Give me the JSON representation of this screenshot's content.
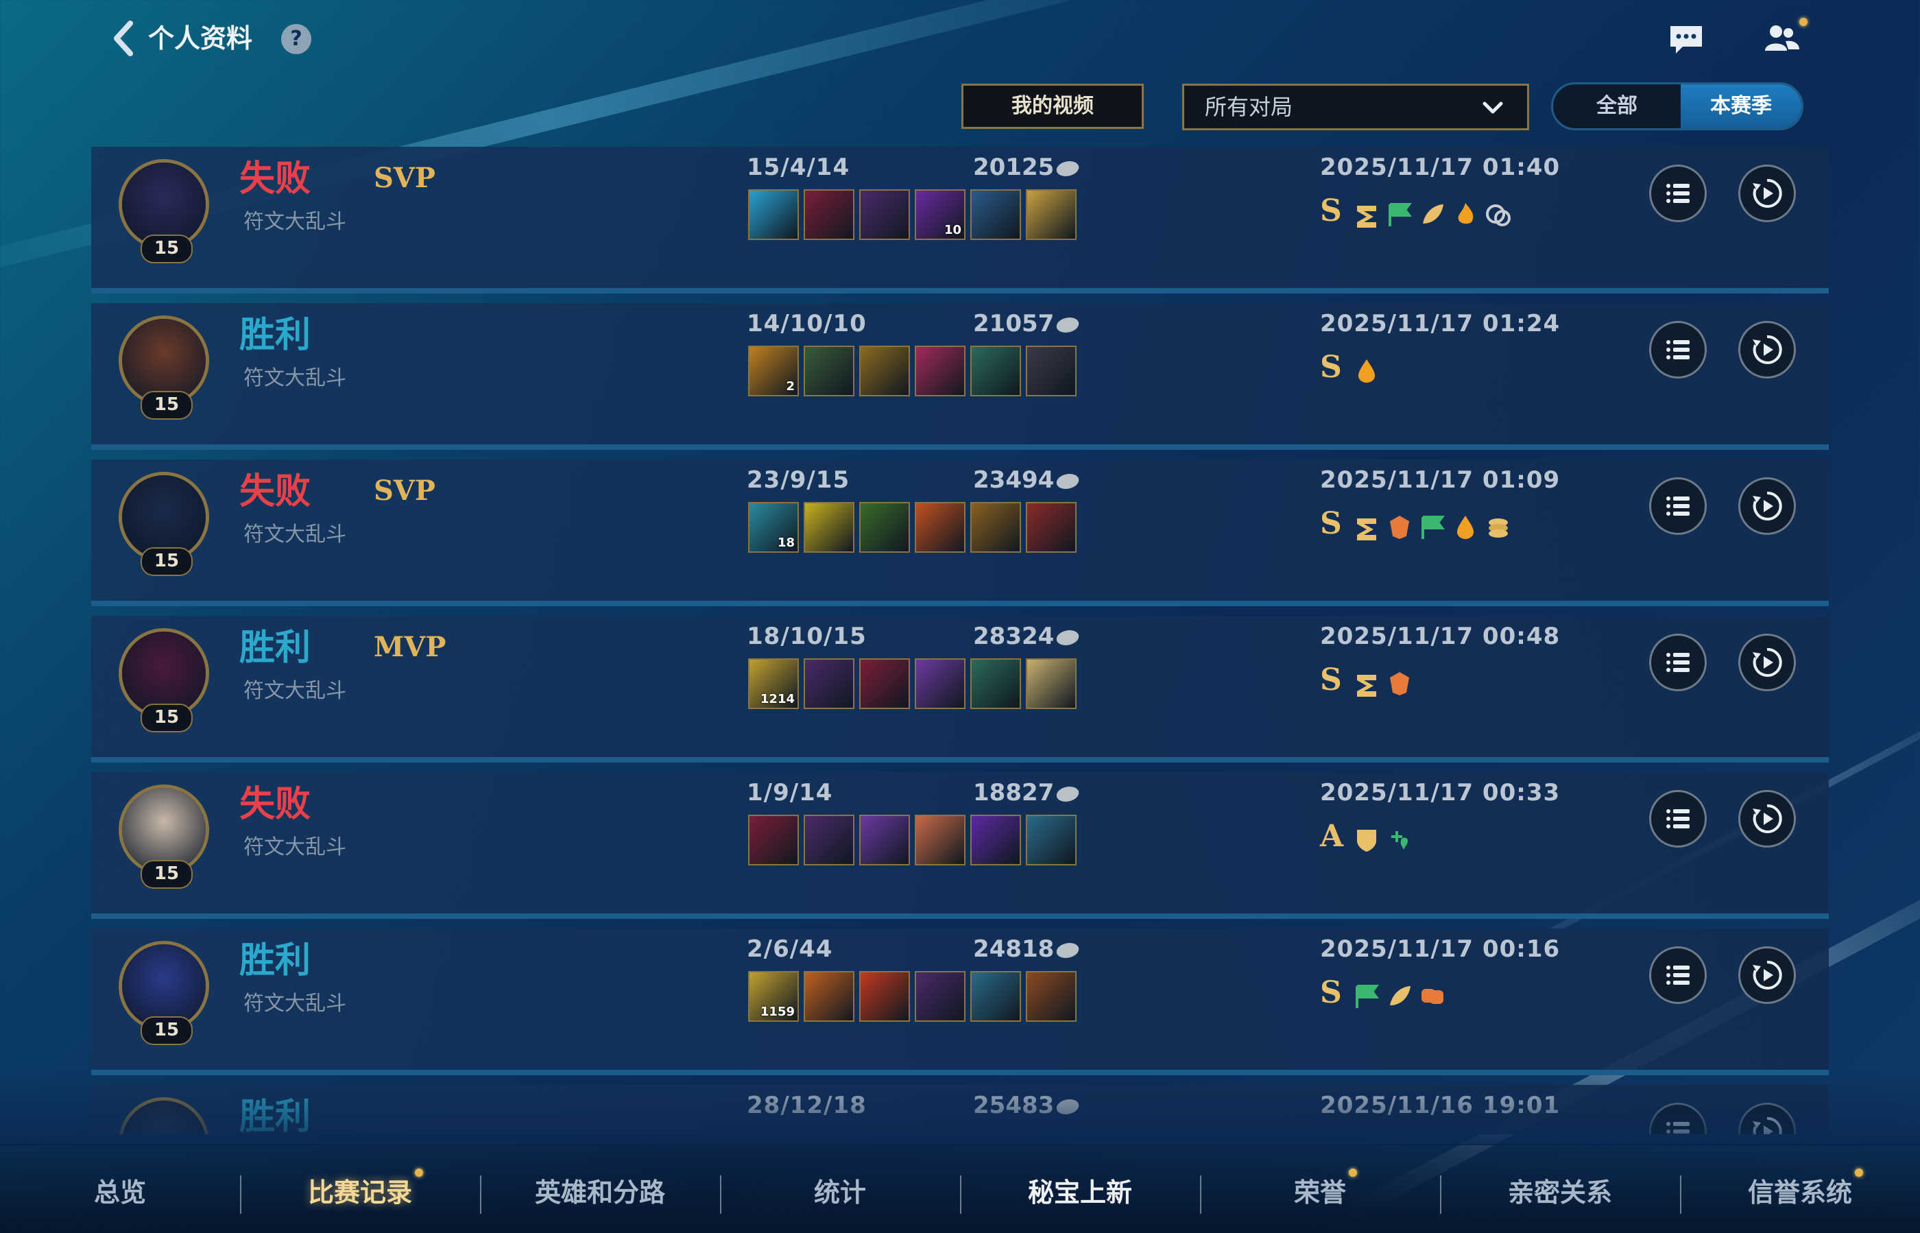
{
  "header": {
    "title": "个人资料",
    "help": "?",
    "video_button": "我的视频",
    "filter_value": "所有对局",
    "toggle": {
      "all": "全部",
      "season": "本赛季"
    }
  },
  "matches": [
    {
      "result": "失败",
      "result_type": "lose",
      "award": "SVP",
      "mode": "符文大乱斗",
      "level": "15",
      "kda": "15/4/14",
      "gold": "20125",
      "date": "2025/11/17 01:40",
      "grade": "S",
      "items": [
        {
          "c": "#2aa0d0",
          "n": ""
        },
        {
          "c": "#7a1e3a",
          "n": ""
        },
        {
          "c": "#4a2a6a",
          "n": ""
        },
        {
          "c": "#6a2aa0",
          "n": "10"
        },
        {
          "c": "#2a5a8a",
          "n": ""
        },
        {
          "c": "#c8a040",
          "n": ""
        }
      ],
      "tags": [
        "three",
        "flag",
        "leaf",
        "flame",
        "coin-link"
      ]
    },
    {
      "result": "胜利",
      "result_type": "win",
      "award": "",
      "mode": "符文大乱斗",
      "level": "15",
      "kda": "14/10/10",
      "gold": "21057",
      "date": "2025/11/17 01:24",
      "grade": "S",
      "items": [
        {
          "c": "#c08020",
          "n": "2"
        },
        {
          "c": "#3a5a3a",
          "n": ""
        },
        {
          "c": "#8a6a20",
          "n": ""
        },
        {
          "c": "#a02a5a",
          "n": ""
        },
        {
          "c": "#2a6a5a",
          "n": ""
        },
        {
          "c": "#3a3a4a",
          "n": ""
        }
      ],
      "tags": [
        "drop"
      ]
    },
    {
      "result": "失败",
      "result_type": "lose",
      "award": "SVP",
      "mode": "符文大乱斗",
      "level": "15",
      "kda": "23/9/15",
      "gold": "23494",
      "date": "2025/11/17 01:09",
      "grade": "S",
      "items": [
        {
          "c": "#2a8aa0",
          "n": "18"
        },
        {
          "c": "#c8b020",
          "n": ""
        },
        {
          "c": "#3a6a2a",
          "n": ""
        },
        {
          "c": "#c05020",
          "n": ""
        },
        {
          "c": "#8a6020",
          "n": ""
        },
        {
          "c": "#8a2a2a",
          "n": ""
        }
      ],
      "tags": [
        "three",
        "crest",
        "flag",
        "drop",
        "coins"
      ]
    },
    {
      "result": "胜利",
      "result_type": "win",
      "award": "MVP",
      "mode": "符文大乱斗",
      "level": "15",
      "kda": "18/10/15",
      "gold": "28324",
      "date": "2025/11/17 00:48",
      "grade": "S",
      "items": [
        {
          "c": "#c0a030",
          "n": "1214"
        },
        {
          "c": "#4a2a6a",
          "n": ""
        },
        {
          "c": "#7a1e3a",
          "n": ""
        },
        {
          "c": "#6a3aa0",
          "n": ""
        },
        {
          "c": "#2a6a5a",
          "n": ""
        },
        {
          "c": "#c8b070",
          "n": ""
        }
      ],
      "tags": [
        "three",
        "crest"
      ]
    },
    {
      "result": "失败",
      "result_type": "lose",
      "award": "",
      "mode": "符文大乱斗",
      "level": "15",
      "kda": "1/9/14",
      "gold": "18827",
      "date": "2025/11/17 00:33",
      "grade": "A",
      "items": [
        {
          "c": "#7a1e3a",
          "n": ""
        },
        {
          "c": "#4a2a6a",
          "n": ""
        },
        {
          "c": "#6a3aa0",
          "n": ""
        },
        {
          "c": "#c86a4a",
          "n": ""
        },
        {
          "c": "#5a2aa0",
          "n": ""
        },
        {
          "c": "#2a6a8a",
          "n": ""
        }
      ],
      "tags": [
        "shield-leaf",
        "heart-plus"
      ]
    },
    {
      "result": "胜利",
      "result_type": "win",
      "award": "",
      "mode": "符文大乱斗",
      "level": "15",
      "kda": "2/6/44",
      "gold": "24818",
      "date": "2025/11/17 00:16",
      "grade": "S",
      "items": [
        {
          "c": "#c0a030",
          "n": "1159"
        },
        {
          "c": "#c06020",
          "n": ""
        },
        {
          "c": "#c03a20",
          "n": ""
        },
        {
          "c": "#4a2a6a",
          "n": ""
        },
        {
          "c": "#2a6a8a",
          "n": ""
        },
        {
          "c": "#8a4a20",
          "n": ""
        }
      ],
      "tags": [
        "flag",
        "leaf",
        "link"
      ]
    },
    {
      "result": "胜利",
      "result_type": "win",
      "award": "",
      "mode": "",
      "level": "",
      "kda": "28/12/18",
      "gold": "25483",
      "date": "2025/11/16 19:01",
      "grade": "",
      "items": [],
      "tags": []
    }
  ],
  "nav": {
    "tabs": [
      {
        "label": "总览",
        "dot": false
      },
      {
        "label": "比赛记录",
        "dot": true
      },
      {
        "label": "英雄和分路",
        "dot": false
      },
      {
        "label": "统计",
        "dot": false
      },
      {
        "label": "秘宝上新",
        "dot": false
      },
      {
        "label": "荣誉",
        "dot": true
      },
      {
        "label": "亲密关系",
        "dot": false
      },
      {
        "label": "信誉系统",
        "dot": true
      }
    ],
    "active_index": 1
  },
  "colors": {
    "lose": "#e8414a",
    "win": "#2aa9cc",
    "gold_accent": "#8a7442",
    "award": "#e2b45a"
  },
  "icons": {
    "back": "chevron-left-icon",
    "help": "question-icon",
    "chat": "chat-bubble-icon",
    "friends": "friends-icon",
    "detail": "list-icon",
    "replay": "replay-icon",
    "gold": "coin-icon",
    "dropdown": "chevron-down-icon"
  }
}
